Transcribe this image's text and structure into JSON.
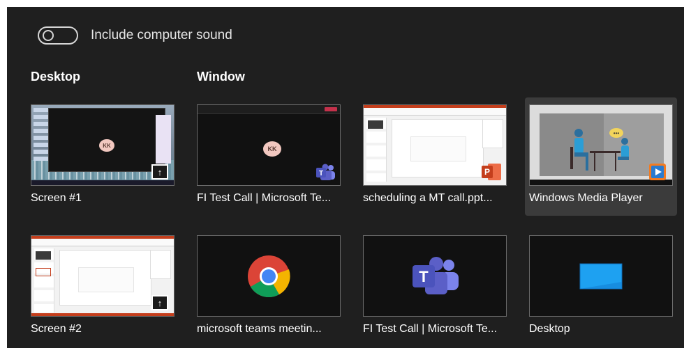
{
  "toggle": {
    "label": "Include computer sound",
    "on": false
  },
  "sections": {
    "desktop": "Desktop",
    "window": "Window"
  },
  "tiles": [
    {
      "label": "Screen #1",
      "kind": "screen",
      "selected": false,
      "avatar_initials": "KK"
    },
    {
      "label": "FI Test Call | Microsoft Te...",
      "kind": "teams-window",
      "selected": false,
      "avatar_initials": "KK"
    },
    {
      "label": "scheduling a MT call.ppt...",
      "kind": "powerpoint-window",
      "selected": false
    },
    {
      "label": "Windows Media Player",
      "kind": "media-player-window",
      "selected": true
    },
    {
      "label": "Screen #2",
      "kind": "screen",
      "selected": false
    },
    {
      "label": "microsoft teams meetin...",
      "kind": "chrome-window",
      "selected": false
    },
    {
      "label": "FI Test Call | Microsoft Te...",
      "kind": "teams-app",
      "selected": false
    },
    {
      "label": "Desktop",
      "kind": "desktop",
      "selected": false
    }
  ],
  "icons": {
    "share": "share-screen-icon",
    "teams": "microsoft-teams-icon",
    "powerpoint": "powerpoint-icon",
    "media_player": "windows-media-player-icon",
    "chrome": "google-chrome-icon",
    "desktop": "desktop-icon"
  },
  "colors": {
    "background": "#1f1f1f",
    "selected_tile": "#3b3b3b",
    "teams_purple": "#5b5fc7",
    "ppt_orange": "#c43e1c",
    "desktop_blue": "#1ea1f1"
  }
}
